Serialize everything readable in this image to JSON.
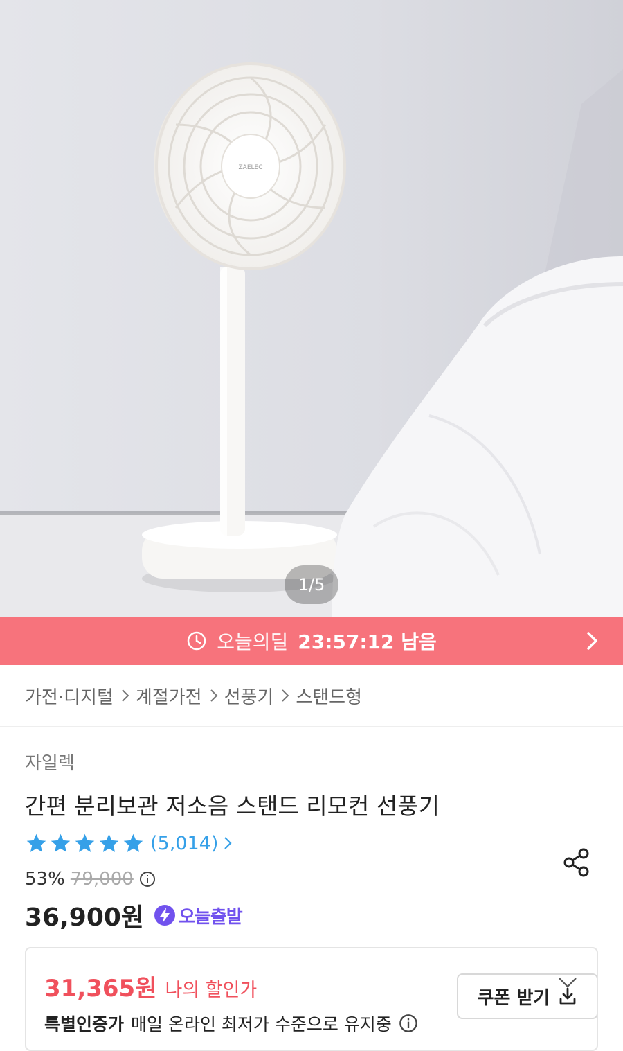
{
  "hero": {
    "fan_brand_text": "ZAELEC",
    "page_indicator": "1/5"
  },
  "deal": {
    "label": "오늘의딜",
    "time": "23:57:12 남음",
    "color": "#f7737c"
  },
  "breadcrumb": {
    "items": [
      "가전·디지털",
      "계절가전",
      "선풍기",
      "스탠드형"
    ]
  },
  "product": {
    "brand": "자일렉",
    "title": "간편 분리보관 저소음 스탠드 리모컨 선풍기",
    "rating_stars": 5,
    "review_count": "(5,014)",
    "discount": "53%",
    "original_price": "79,000",
    "price": "36,900원",
    "today_ship_label": "오늘출발",
    "coupon_button": "쿠폰 받기"
  },
  "my_price": {
    "value": "31,365원",
    "label": "나의 할인가",
    "cert_strong": "특별인증가",
    "cert_text": "매일 온라인 최저가 수준으로 유지중"
  },
  "colors": {
    "accent_red": "#f0505c",
    "star_blue": "#35a0e8",
    "today_purple": "#7152ee"
  }
}
